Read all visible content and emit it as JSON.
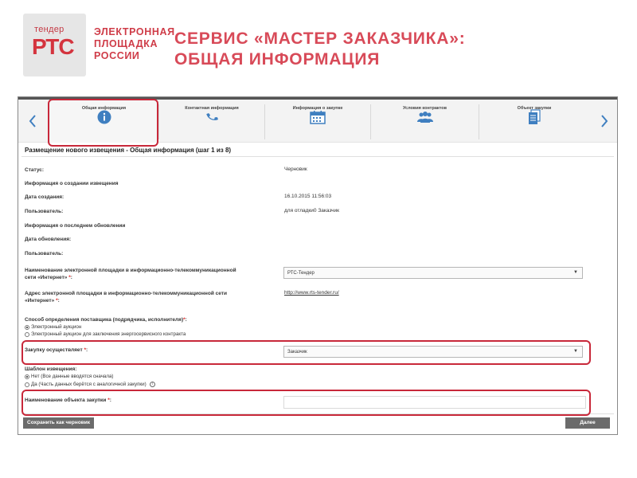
{
  "header": {
    "logo_small": "тендер",
    "logo_main": "РТС",
    "logo_caption": [
      "ЭЛЕКТРОННАЯ",
      "ПЛОЩАДКА",
      "РОССИИ"
    ],
    "title_lines": [
      "СЕРВИС «МАСТЕР ЗАКАЗЧИКА»:",
      "ОБЩАЯ ИНФОРМАЦИЯ"
    ]
  },
  "wizard": {
    "prev_icon": "chevron-left-icon",
    "next_icon": "chevron-right-icon",
    "steps": [
      {
        "label": "Общая информация",
        "icon": "info-icon",
        "active": true
      },
      {
        "label": "Контактная информация",
        "icon": "phone-icon",
        "active": false
      },
      {
        "label": "Информация о закупке",
        "icon": "calendar-icon",
        "active": false
      },
      {
        "label": "Условия контрактов",
        "icon": "people-icon",
        "active": false
      },
      {
        "label": "Объект закупки",
        "icon": "documents-icon",
        "active": false
      }
    ],
    "accent_color": "#3f7fc0"
  },
  "form": {
    "title": "Размещение нового извещения - Общая информация (шаг 1 из 8)",
    "status_label": "Статус:",
    "status_value": "Черновик",
    "creation_info_label": "Информация о создании извещения",
    "created_date_label": "Дата создания:",
    "created_date_value": "16.10.2015 11:56:03",
    "user_label": "Пользователь:",
    "user_value": "для отладки0 Заказчик",
    "last_update_label": "Информация о последнем обновлении",
    "update_date_label": "Дата обновления:",
    "update_user_label": "Пользователь:",
    "platform_name_label_1": "Наименование электронной площадки в информационно-телекоммуникационной",
    "platform_name_label_2": "сети «Интернет»",
    "platform_name_value": "РТС-Тендер",
    "platform_address_label_1": "Адрес электронной площадки в информационно-телекоммуникационной сети",
    "platform_address_label_2": "«Интернет»",
    "platform_address_value": "http://www.rts-tender.ru/",
    "supplier_method_label": "Способ определения поставщика (подрядчика, исполнителя)",
    "supplier_method_options": [
      {
        "label": "Электронный аукцион",
        "selected": true
      },
      {
        "label": "Электронный аукцион для заключения энергосервисного контракта",
        "selected": false
      }
    ],
    "purchaser_label": "Закупку осуществляет",
    "purchaser_value": "Заказчик",
    "template_label": "Шаблон извещения:",
    "template_options": [
      {
        "label": "Нет (Все данные вводятся сначала)",
        "selected": true
      },
      {
        "label": "Да (Часть данных берётся с аналогичной закупки)",
        "selected": false
      }
    ],
    "object_name_label": "Наименование объекта закупки",
    "object_name_value": "",
    "required_mark": "*",
    "colon": ":"
  },
  "buttons": {
    "save_draft": "Сохранить как черновик",
    "next": "Далее"
  },
  "colors": {
    "brand_red": "#d4343e",
    "highlight_red": "#c8283a",
    "button_gray": "#6b6b6b"
  }
}
